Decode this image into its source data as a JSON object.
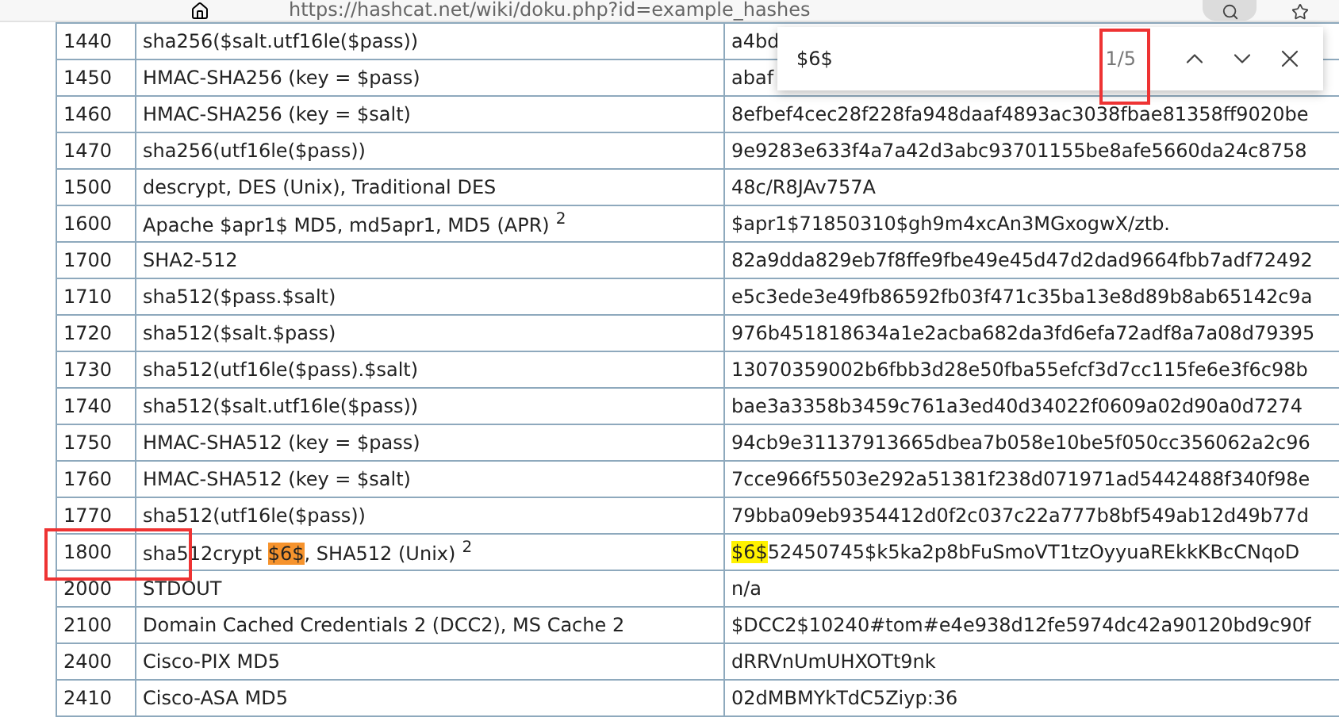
{
  "address_bar": {
    "url": "https://hashcat.net/wiki/doku.php?id=example_hashes"
  },
  "find_bar": {
    "query": "$6$",
    "match_count": "1/5",
    "count_annotated": true
  },
  "table": {
    "rows": [
      {
        "mode": "1440",
        "name": "sha256($salt.utf16le($pass))",
        "hash": "a4bd"
      },
      {
        "mode": "1450",
        "name": "HMAC-SHA256 (key = $pass)",
        "hash": "abaf"
      },
      {
        "mode": "1460",
        "name": "HMAC-SHA256 (key = $salt)",
        "hash": "8efbef4cec28f228fa948daaf4893ac3038fbae81358ff9020be"
      },
      {
        "mode": "1470",
        "name": "sha256(utf16le($pass))",
        "hash": "9e9283e633f4a7a42d3abc93701155be8afe5660da24c8758"
      },
      {
        "mode": "1500",
        "name": "descrypt, DES (Unix), Traditional DES",
        "hash": "48c/R8JAv757A"
      },
      {
        "mode": "1600",
        "name": "Apache $apr1$ MD5, md5apr1, MD5 (APR)",
        "footnote": "2",
        "hash": "$apr1$71850310$gh9m4xcAn3MGxogwX/ztb."
      },
      {
        "mode": "1700",
        "name": "SHA2-512",
        "hash": "82a9dda829eb7f8ffe9fbe49e45d47d2dad9664fbb7adf72492"
      },
      {
        "mode": "1710",
        "name": "sha512($pass.$salt)",
        "hash": "e5c3ede3e49fb86592fb03f471c35ba13e8d89b8ab65142c9a"
      },
      {
        "mode": "1720",
        "name": "sha512($salt.$pass)",
        "hash": "976b451818634a1e2acba682da3fd6efa72adf8a7a08d79395"
      },
      {
        "mode": "1730",
        "name": "sha512(utf16le($pass).$salt)",
        "hash": "13070359002b6fbb3d28e50fba55efcf3d7cc115fe6e3f6c98b"
      },
      {
        "mode": "1740",
        "name": "sha512($salt.utf16le($pass))",
        "hash": "bae3a3358b3459c761a3ed40d34022f0609a02d90a0d7274"
      },
      {
        "mode": "1750",
        "name": "HMAC-SHA512 (key = $pass)",
        "hash": "94cb9e31137913665dbea7b058e10be5f050cc356062a2c96"
      },
      {
        "mode": "1760",
        "name": "HMAC-SHA512 (key = $salt)",
        "hash": "7cce966f5503e292a51381f238d071971ad5442488f340f98e"
      },
      {
        "mode": "1770",
        "name": "sha512(utf16le($pass))",
        "hash": "79bba09eb9354412d0f2c037c22a777b8bf549ab12d49b77d"
      },
      {
        "mode": "1800",
        "annotated": true,
        "name": [
          {
            "text": "sha512crypt "
          },
          {
            "text": "$6$",
            "match": true,
            "current": true
          },
          {
            "text": ", SHA512 (Unix)"
          }
        ],
        "footnote": "2",
        "hash": [
          {
            "text": "$6$",
            "match": true,
            "current": false
          },
          {
            "text": "52450745$k5ka2p8bFuSmoVT1tzOyyuaREkkKBcCNqoD"
          }
        ]
      },
      {
        "mode": "2000",
        "name": "STDOUT",
        "hash": "n/a"
      },
      {
        "mode": "2100",
        "name": "Domain Cached Credentials 2 (DCC2), MS Cache 2",
        "hash": "$DCC2$10240#tom#e4e938d12fe5974dc42a90120bd9c90f"
      },
      {
        "mode": "2400",
        "name": "Cisco-PIX MD5",
        "hash": "dRRVnUmUHXOTt9nk"
      },
      {
        "mode": "2410",
        "name": "Cisco-ASA MD5",
        "hash": "02dMBMYkTdC5Ziyp:36"
      }
    ]
  }
}
